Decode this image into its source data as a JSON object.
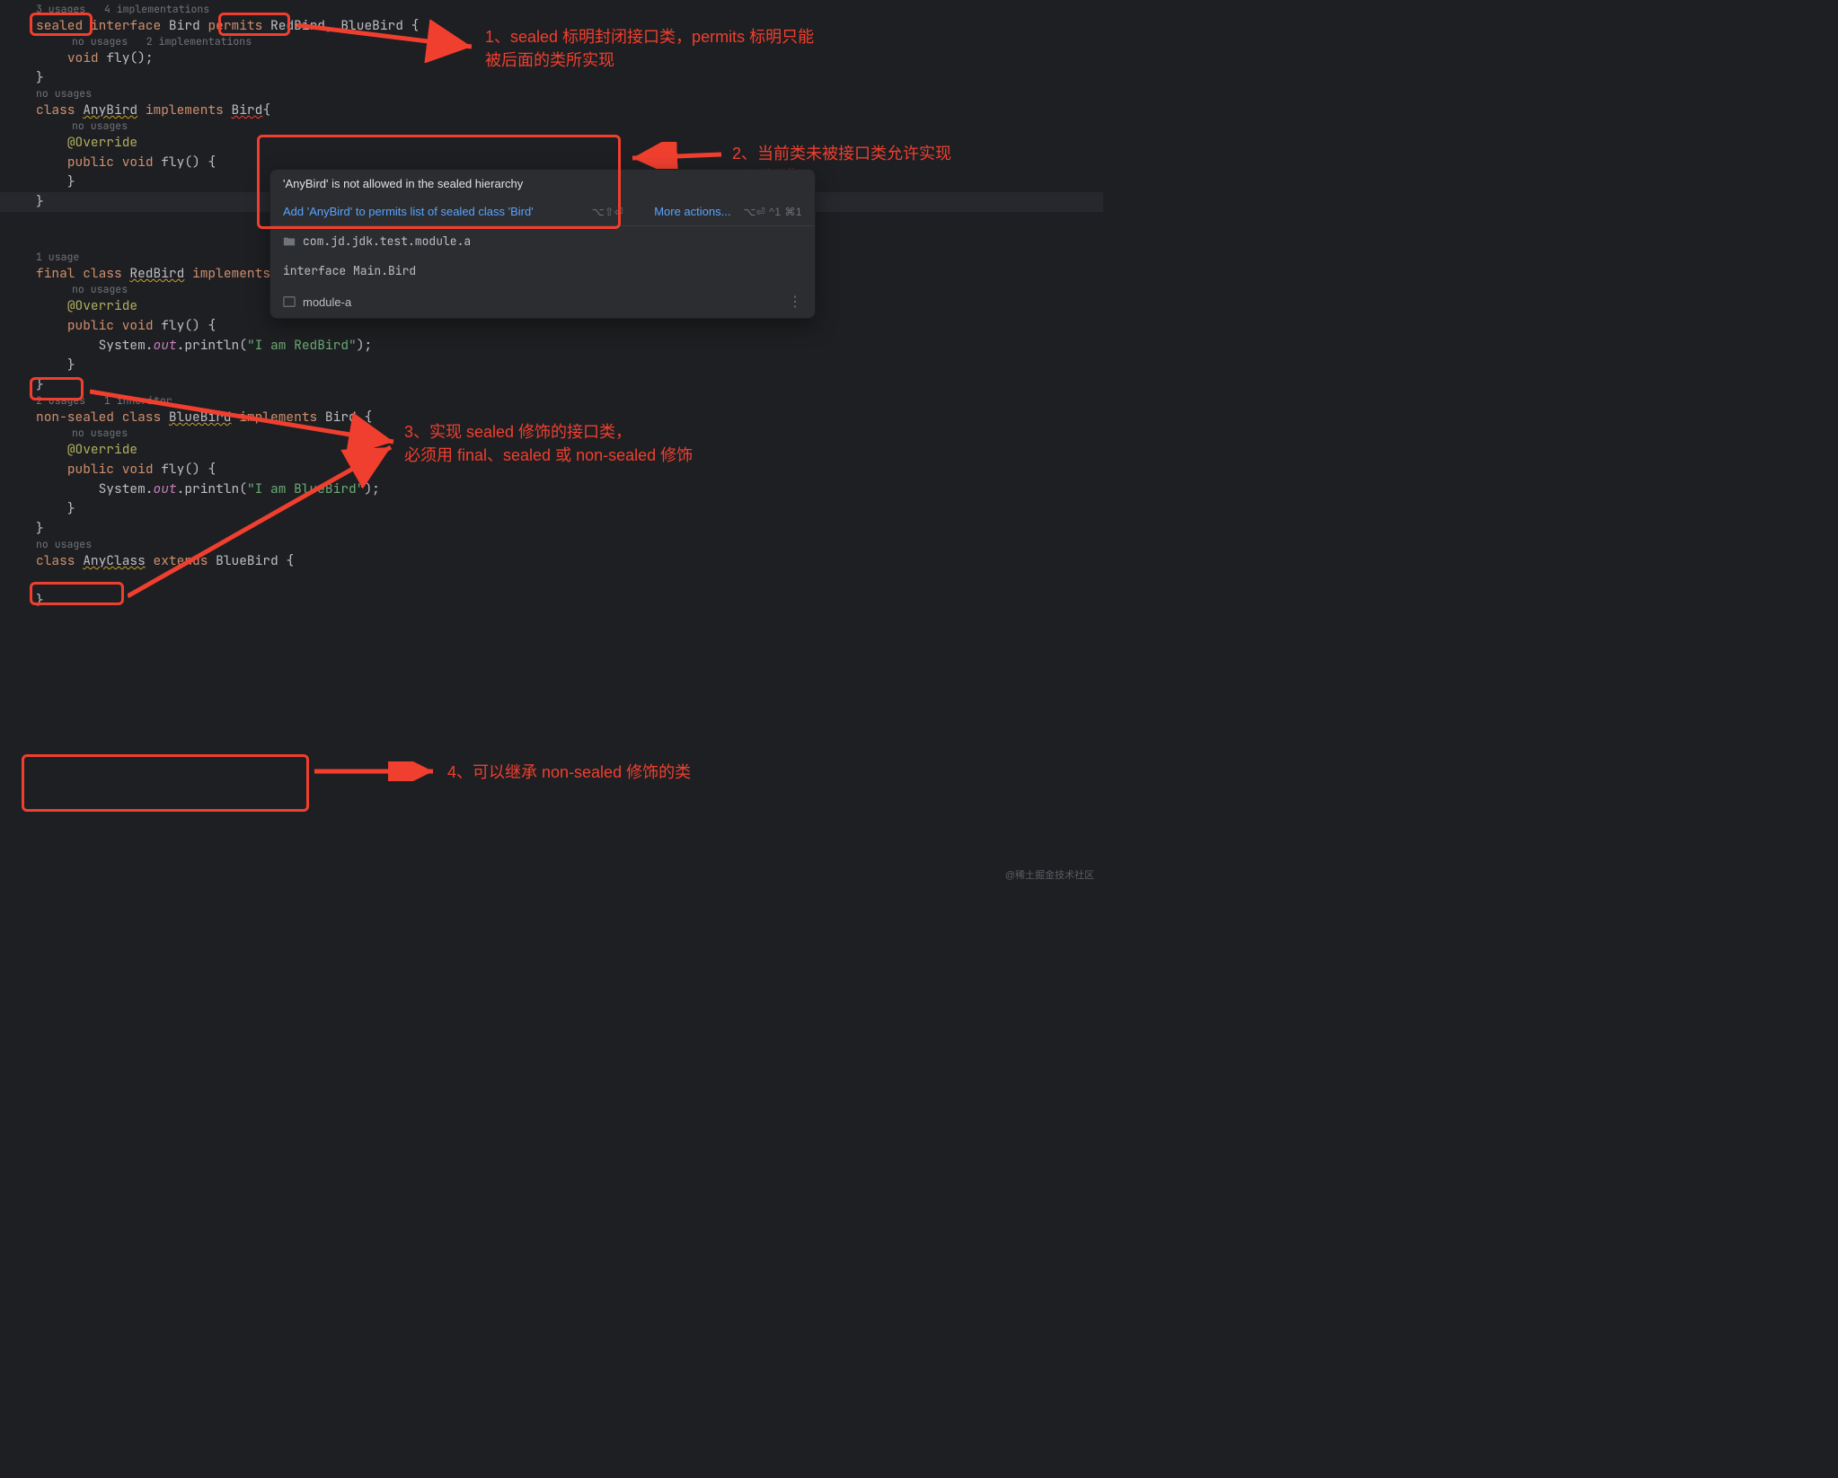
{
  "hints": {
    "bird_iface": "3 usages   4 implementations",
    "fly_iface": "no usages   2 implementations",
    "anybird": "no usages",
    "anybird_inner": "no usages",
    "redbird": "1 usage",
    "redbird_inner": "no usages",
    "bluebird": "2 usages   1 inheritor",
    "bluebird_inner": "no usages",
    "anyclass": "no usages"
  },
  "code": {
    "sealed": "sealed",
    "interface_kw": "interface",
    "bird": "Bird",
    "permits": "permits",
    "permits_list": " RedBird, BlueBird {",
    "fly_decl_void": "void",
    "fly_decl_name": "fly",
    "fly_decl_rest": "();",
    "close": "}",
    "class_kw": "class",
    "anybird": "AnyBird",
    "implements_kw": "implements",
    "bird_err": "Bird",
    "open": "{",
    "override": "@Override",
    "public_kw": "public",
    "void_kw": "void",
    "method_open": "() {",
    "final_kw": "final",
    "redbird": "RedBird",
    "sysout_pre": "System.",
    "sysout_out": "out",
    "println": ".println(",
    "str_red": "\"I am RedBird\"",
    "str_blue": "\"I am BlueBird\"",
    "close_paren": ");",
    "nonsealed": "non-sealed",
    "bluebird": "BlueBird",
    "anyclass": "AnyClass",
    "extends_kw": "extends"
  },
  "popup": {
    "error": "'AnyBird' is not allowed in the sealed hierarchy",
    "fix": "Add 'AnyBird' to permits list of sealed class 'Bird'",
    "fix_sc": "⌥⇧⏎",
    "more": "More actions...",
    "more_sc": "⌥⏎ ^1 ⌘1",
    "pkg": "com.jd.jdk.test.module.a",
    "iface": "interface Main.Bird",
    "mod": "module-a"
  },
  "annots": {
    "a1": "1、sealed 标明封闭接口类，permits 标明只能\n被后面的类所实现",
    "a2": "2、当前类未被接口类允许实现\n所以报错",
    "a3": "3、实现 sealed 修饰的接口类，\n必须用 final、sealed 或 non-sealed 修饰",
    "a4": "4、可以继承 non-sealed 修饰的类"
  },
  "watermark": "@稀土掘金技术社区"
}
